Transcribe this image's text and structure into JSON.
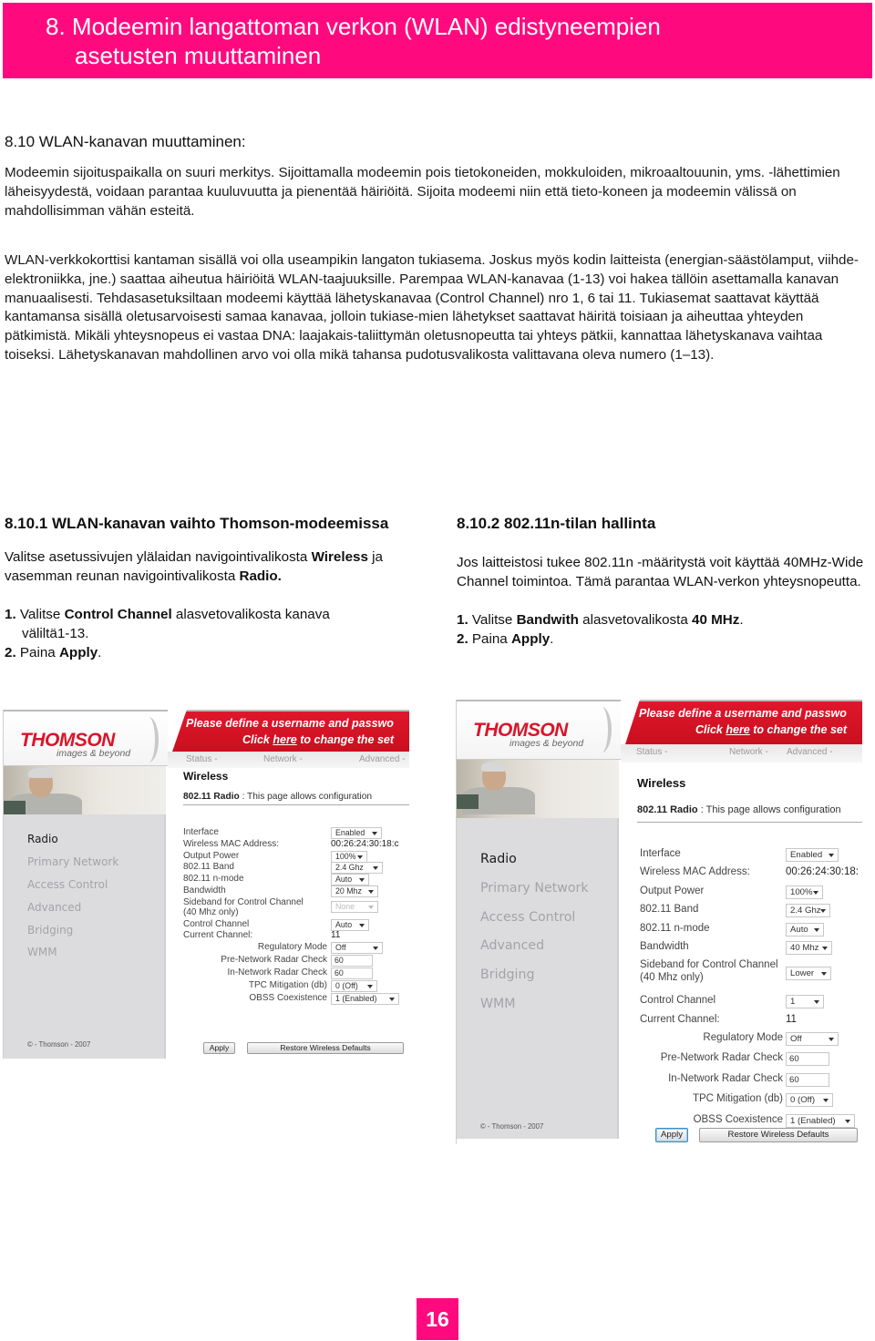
{
  "banner": {
    "title_line1": "8. Modeemin langattoman verkon (WLAN) edistyneempien",
    "title_line2": "asetusten muuttaminen",
    "color": "#ff0a7e"
  },
  "section": {
    "heading": "8.10 WLAN-kanavan muuttaminen:",
    "paragraph1": "Modeemin sijoituspaikalla on suuri merkitys. Sijoittamalla modeemin pois tietokoneiden, mokkuloiden, mikroaaltouunin, yms. -lähettimien läheisyydestä, voidaan parantaa kuuluvuutta ja pienentää häiriöitä. Sijoita modeemi niin että tieto-koneen ja modeemin välissä on mahdollisimman vähän esteitä.",
    "paragraph2": "WLAN-verkkokorttisi kantaman sisällä voi olla useampikin langaton tukiasema. Joskus myös kodin laitteista (energian-säästölamput, viihde-elektroniikka, jne.) saattaa aiheutua häiriöitä WLAN-taajuuksille. Parempaa WLAN-kanavaa (1-13) voi hakea tällöin asettamalla kanavan manuaalisesti. Tehdasasetuksiltaan modeemi käyttää lähetyskanavaa (Control Channel) nro 1, 6 tai 11. Tukiasemat saattavat käyttää kantamansa sisällä oletusarvoisesti samaa kanavaa, jolloin tukiase-mien lähetykset saattavat häiritä toisiaan ja aiheuttaa yhteyden pätkimistä. Mikäli yhteysnopeus ei vastaa DNA: laajakais-taliittymän oletusnopeutta tai yhteys pätkii, kannattaa lähetyskanava vaihtaa toiseksi. Lähetyskanavan mahdollinen arvo voi olla mikä tahansa pudotusvalikosta valittavana oleva numero (1–13)."
  },
  "left_column": {
    "heading": "8.10.1 WLAN-kanavan vaihto Thomson-modeemissa",
    "intro_pre": "Valitse asetussivujen ylälaidan navigointivalikosta ",
    "intro_bold1": "Wireless",
    "intro_mid": " ja vasemman reunan navigointivalikosta ",
    "intro_bold2": "Radio.",
    "step1_num": "1.",
    "step1_pre": " Valitse ",
    "step1_bold": "Control Channel",
    "step1_post": " alasvetovalikosta kanava",
    "step1_cont": "väliltä1-13.",
    "step2_num": "2.",
    "step2_pre": " Paina ",
    "step2_bold": "Apply",
    "step2_post": "."
  },
  "right_column": {
    "heading": "8.10.2 802.11n-tilan hallinta",
    "intro": "Jos laitteistosi tukee 802.11n -määritystä voit käyttää 40MHz-Wide Channel toimintoa. Tämä parantaa WLAN-verkon yhteysnopeutta.",
    "step1_num": "1.",
    "step1_pre": " Valitse ",
    "step1_bold": "Bandwith",
    "step1_mid": " alasvetovalikosta ",
    "step1_bold2": "40 MHz",
    "step1_post": ".",
    "step2_num": "2.",
    "step2_pre": " Paina ",
    "step2_bold": "Apply",
    "step2_post": "."
  },
  "thomson_ui_common": {
    "logo": "THOMSON",
    "logo_tagline": "images & beyond",
    "notice_line1": "Please define a username and passwo",
    "notice_line2_pre": "Click ",
    "notice_link": "here",
    "notice_line2_post": " to change the set",
    "nav_tabs": [
      "Status -",
      "Network -",
      "Advanced -"
    ],
    "page_title": "Wireless",
    "page_subtitle_bold": "802.11 Radio",
    "page_subtitle": " :  This page allows configuration",
    "sidebar_items": [
      "Radio",
      "Primary Network",
      "Access Control",
      "Advanced",
      "Bridging",
      "WMM"
    ],
    "sidebar_active": "Radio",
    "copyright": "© - Thomson - 2007",
    "labels": {
      "interface": "Interface",
      "mac": "Wireless MAC Address:",
      "output_power": "Output Power",
      "band": "802.11 Band",
      "nmode": "802.11 n-mode",
      "bandwidth": "Bandwidth",
      "sideband1": "Sideband for Control Channel",
      "sideband2": "(40 Mhz only)",
      "control_channel": "Control Channel",
      "current_channel": "Current Channel:",
      "regulatory_mode": "Regulatory Mode",
      "pre_radar": "Pre-Network Radar Check",
      "in_radar": "In-Network Radar Check",
      "tpc": "TPC Mitigation (db)",
      "obss": "OBSS Coexistence"
    },
    "apply_button": "Apply",
    "restore_button": "Restore Wireless Defaults"
  },
  "screenshot_left": {
    "interface": "Enabled",
    "mac": "00:26:24:30:18:c",
    "output_power": "100%",
    "band": "2.4 Ghz",
    "nmode": "Auto",
    "bandwidth": "20 Mhz",
    "sideband": "None",
    "sideband_disabled": true,
    "control_channel": "Auto",
    "current_channel": "11",
    "regulatory_mode": "Off",
    "pre_radar": "60",
    "in_radar": "60",
    "tpc": "0 (Off)",
    "obss": "1 (Enabled)"
  },
  "screenshot_right": {
    "interface": "Enabled",
    "mac": "00:26:24:30:18:",
    "output_power": "100%",
    "band": "2.4 Ghz",
    "nmode": "Auto",
    "bandwidth": "40 Mhz",
    "sideband": "Lower",
    "sideband_disabled": false,
    "control_channel": "1",
    "current_channel": "11",
    "regulatory_mode": "Off",
    "pre_radar": "60",
    "in_radar": "60",
    "tpc": "0 (Off)",
    "obss": "1 (Enabled)"
  },
  "page_number": "16"
}
